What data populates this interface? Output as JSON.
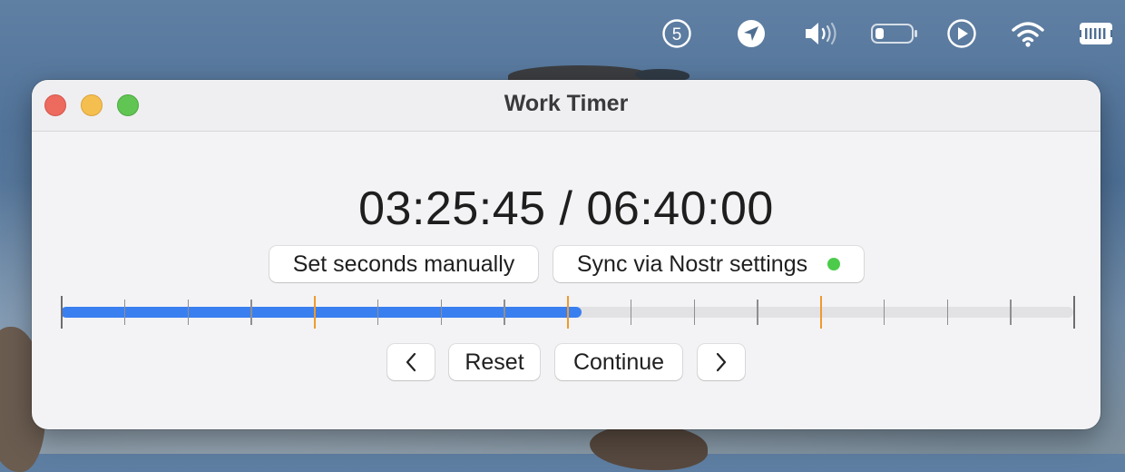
{
  "menubar": {
    "icons": [
      "number-5-circle-icon",
      "location-arrow-icon",
      "speaker-volume-icon",
      "battery-icon",
      "play-circle-icon",
      "wifi-icon",
      "keyboard-memory-icon"
    ],
    "badge_number": "5"
  },
  "window": {
    "title": "Work Timer"
  },
  "timer": {
    "elapsed": "03:25:45",
    "separator": "/",
    "total": "06:40:00",
    "progress_fraction": 0.5144
  },
  "buttons": {
    "set_seconds": "Set seconds manually",
    "sync": "Sync via Nostr settings",
    "prev": "‹",
    "reset": "Reset",
    "continue": "Continue",
    "next": "›"
  },
  "colors": {
    "progress_fill": "#3a7ff0",
    "major_tick": "#ef9a2d",
    "sync_status": "#4ccb4a"
  }
}
